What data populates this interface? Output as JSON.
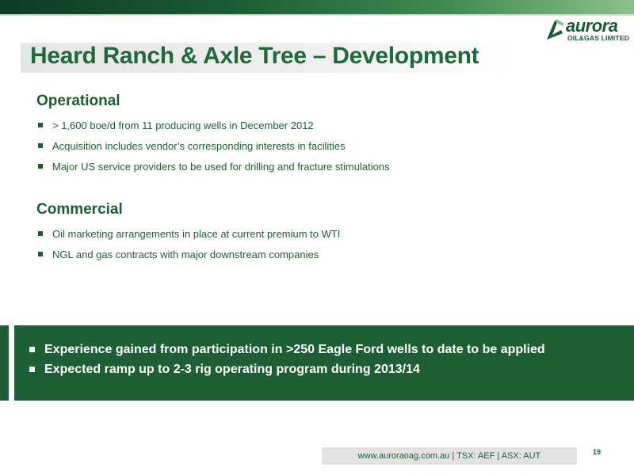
{
  "logo": {
    "word": "aurora",
    "sub": "OIL&GAS LIMITED"
  },
  "title": "Heard Ranch & Axle Tree – Development",
  "operational": {
    "heading": "Operational",
    "items": [
      "> 1,600 boe/d from 11 producing wells in December 2012",
      "Acquisition includes vendor’s corresponding interests in facilities",
      "Major US service providers to be used for drilling and fracture stimulations"
    ]
  },
  "commercial": {
    "heading": "Commercial",
    "items": [
      "Oil marketing arrangements in place at current premium to WTI",
      "NGL and gas contracts with major downstream companies"
    ]
  },
  "highlight": {
    "items": [
      "Experience gained from participation in >250 Eagle Ford wells to date to be applied",
      "Expected ramp up to 2-3 rig operating program during 2013/14"
    ]
  },
  "footer": {
    "text": "www.auroraoag.com.au   |   TSX: AEF   |   ASX: AUT"
  },
  "page_number": "19",
  "colors": {
    "brand_green": "#1e5e34",
    "title_green": "#1e6b3a"
  }
}
